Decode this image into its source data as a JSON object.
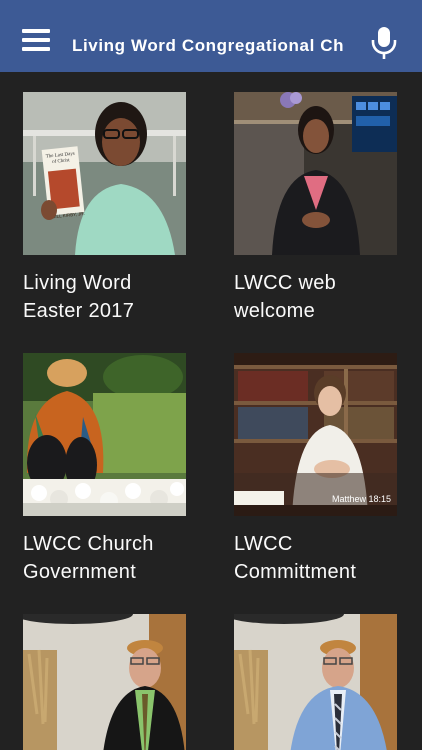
{
  "app": {
    "title": "Living Word Congregational Ch",
    "menu_icon": "menu-icon",
    "mic_icon": "microphone-icon",
    "accent": "#3D5A95",
    "background": "#222222"
  },
  "videos": [
    {
      "title": "Living Word Easter 2017",
      "book_caption": "The Last Days of Christ",
      "book_author": "BILL KIRBY, JR."
    },
    {
      "title": "LWCC web welcome"
    },
    {
      "title": "LWCC Church Government"
    },
    {
      "title": "LWCC Committment",
      "overlay_caption": "Matthew 18:15"
    },
    {
      "title": ""
    },
    {
      "title": ""
    }
  ]
}
